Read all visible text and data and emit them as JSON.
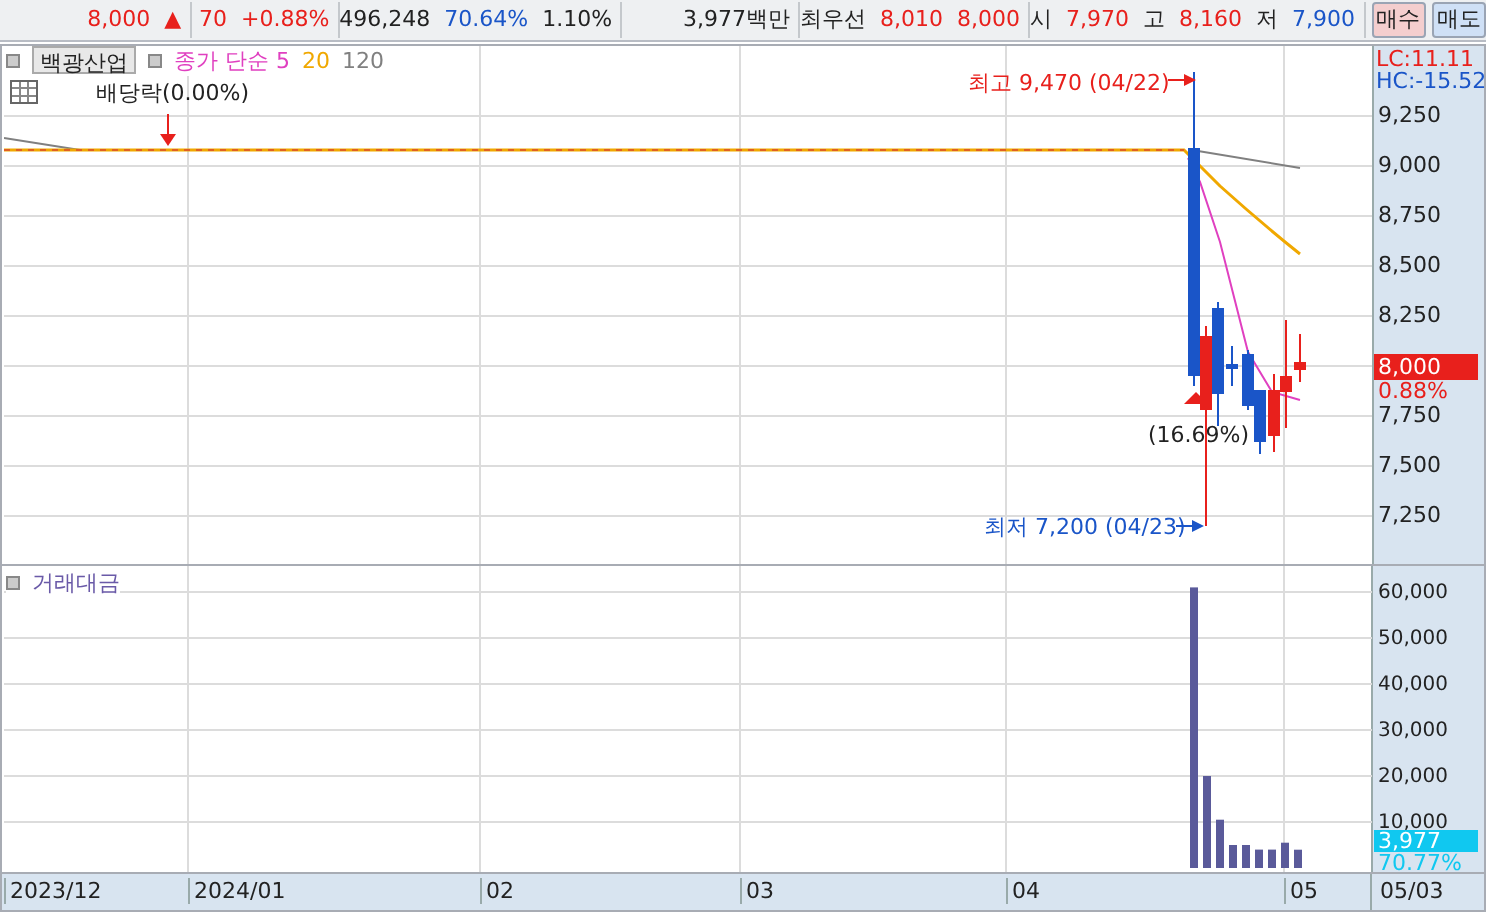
{
  "quote_bar": {
    "price": "8,000",
    "change_sign": "▲",
    "change": "70",
    "change_rate": "+0.88%",
    "volume": "496,248",
    "volume_ratio": "70.64%",
    "turnover_rate": "1.10%",
    "trade_value": "3,977백만",
    "best_label": "최우선",
    "best_ask": "8,010",
    "best_bid": "8,000",
    "open_label": "시",
    "open": "7,970",
    "high_label": "고",
    "high": "8,160",
    "low_label": "저",
    "low": "7,900",
    "buttons": [
      {
        "label": "매수",
        "kind": "buy"
      },
      {
        "label": "매도",
        "kind": "sell"
      }
    ]
  },
  "price_panel": {
    "stock_button": "백광산업",
    "legend": [
      {
        "label": "종가 단순 5",
        "color": "#e040c0"
      },
      {
        "label": "20",
        "color": "#f0a800"
      },
      {
        "label": "120",
        "color": "#808080"
      }
    ],
    "lc": "LC:11.11",
    "hc": "HC:-15.52",
    "annotations": {
      "ex_dividend": "배당락(0.00%)",
      "high": "최고 9,470 (04/22)",
      "low": "최저 7,200 (04/23)",
      "drop": "(16.69%)"
    },
    "axis_labels": [
      "9,250",
      "9,000",
      "8,750",
      "8,500",
      "8,250",
      "7,750",
      "7,500",
      "7,250"
    ],
    "current_price": "8,000",
    "current_rate": "0.88%"
  },
  "volume_panel": {
    "title": "거래대금",
    "current": "3,977",
    "current_rate": "70.77%",
    "axis_labels": [
      "60,000",
      "50,000",
      "40,000",
      "30,000",
      "20,000",
      "10,000"
    ]
  },
  "date_axis": [
    "2023/12",
    "2024/01",
    "02",
    "03",
    "04",
    "05",
    "05/03"
  ]
}
